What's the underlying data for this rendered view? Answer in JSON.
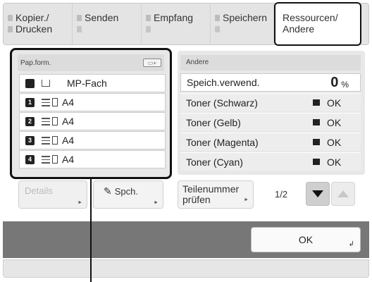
{
  "tabs": [
    {
      "line1": "Kopier./",
      "line2": "Drucken",
      "selected": false
    },
    {
      "line1": "Senden",
      "line2": "",
      "selected": false
    },
    {
      "line1": "Empfang",
      "line2": "",
      "selected": false
    },
    {
      "line1": "Speichern",
      "line2": "",
      "selected": false
    },
    {
      "line1": "Ressourcen/",
      "line2": "Andere",
      "selected": true
    }
  ],
  "paper": {
    "header": "Pap.form.",
    "rows": [
      {
        "tray": "",
        "size": "MP-Fach"
      },
      {
        "tray": "1",
        "size": "A4"
      },
      {
        "tray": "2",
        "size": "A4"
      },
      {
        "tray": "3",
        "size": "A4"
      },
      {
        "tray": "4",
        "size": "A4"
      }
    ]
  },
  "other": {
    "header": "Andere",
    "memory_label": "Speich.verwend.",
    "memory_value": "0",
    "memory_unit": "%",
    "toner": [
      {
        "label": "Toner (Schwarz)",
        "status": "OK"
      },
      {
        "label": "Toner (Gelb)",
        "status": "OK"
      },
      {
        "label": "Toner (Magenta)",
        "status": "OK"
      },
      {
        "label": "Toner (Cyan)",
        "status": "OK"
      }
    ]
  },
  "buttons": {
    "details": "Details",
    "save": "Spch.",
    "part_line1": "Teilenummer",
    "part_line2": "prüfen",
    "page": "1/2",
    "ok": "OK"
  }
}
